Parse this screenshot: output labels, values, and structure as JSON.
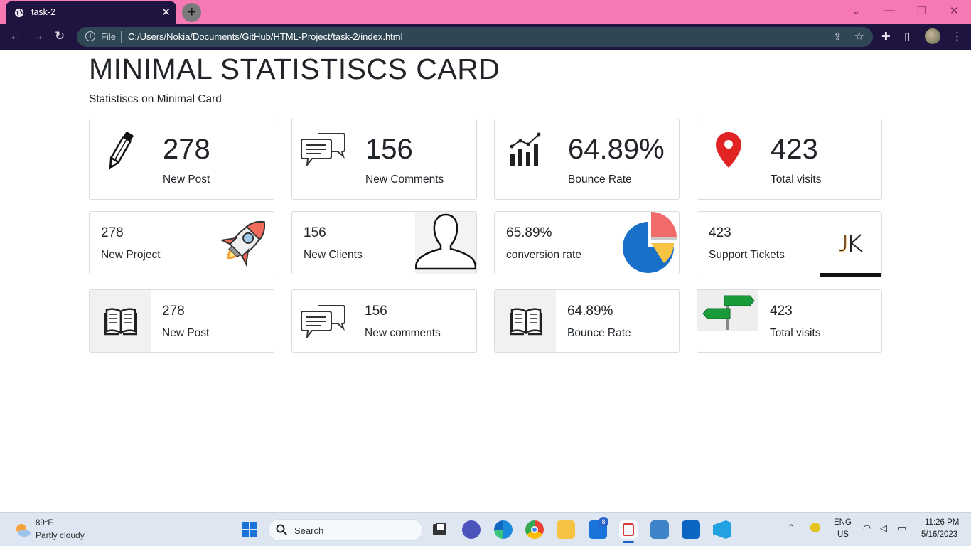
{
  "browser": {
    "tab_title": "task-2",
    "tab_close": "✕",
    "new_tab": "+",
    "omnibox_scheme": "File",
    "url": "C:/Users/Nokia/Documents/GitHub/HTML-Project/task-2/index.html"
  },
  "page": {
    "title": "MINIMAL STATISTISCS CARD",
    "subtitle": "Statistiscs on Minimal Card"
  },
  "row1": [
    {
      "value": "278",
      "label": "New Post",
      "icon": "pencil-icon"
    },
    {
      "value": "156",
      "label": "New Comments",
      "icon": "chat-bubbles-icon"
    },
    {
      "value": "64.89%",
      "label": "Bounce Rate",
      "icon": "bar-chart-icon"
    },
    {
      "value": "423",
      "label": "Total visits",
      "icon": "map-pin-icon"
    }
  ],
  "row2": [
    {
      "value": "278",
      "label": "New Project",
      "icon": "rocket-icon"
    },
    {
      "value": "156",
      "label": "New Clients",
      "icon": "person-silhouette-icon"
    },
    {
      "value": "65.89%",
      "label": "conversion rate",
      "icon": "pie-chart-icon"
    },
    {
      "value": "423",
      "label": "Support Tickets",
      "icon": "jk-logo"
    }
  ],
  "row3": [
    {
      "value": "278",
      "label": "New Post",
      "icon": "open-book-icon"
    },
    {
      "value": "156",
      "label": "New comments",
      "icon": "chat-bubbles-icon"
    },
    {
      "value": "64.89%",
      "label": "Bounce Rate",
      "icon": "open-book-icon"
    },
    {
      "value": "423",
      "label": "Total visits",
      "icon": "signpost-icon"
    }
  ],
  "colors": {
    "tabbar": "#f679b4",
    "toolbar": "#1f1440",
    "pin_red": "#e02424",
    "pie_blue": "#1a6fc9",
    "pie_red": "#f26b6b",
    "pie_yellow": "#f6c343",
    "sign_green": "#1a9b3a"
  },
  "taskbar": {
    "temp": "89°F",
    "condition": "Partly cloudy",
    "search_placeholder": "Search",
    "mail_badge": "8",
    "lang_top": "ENG",
    "lang_bottom": "US",
    "time": "11:26 PM",
    "date": "5/16/2023"
  }
}
